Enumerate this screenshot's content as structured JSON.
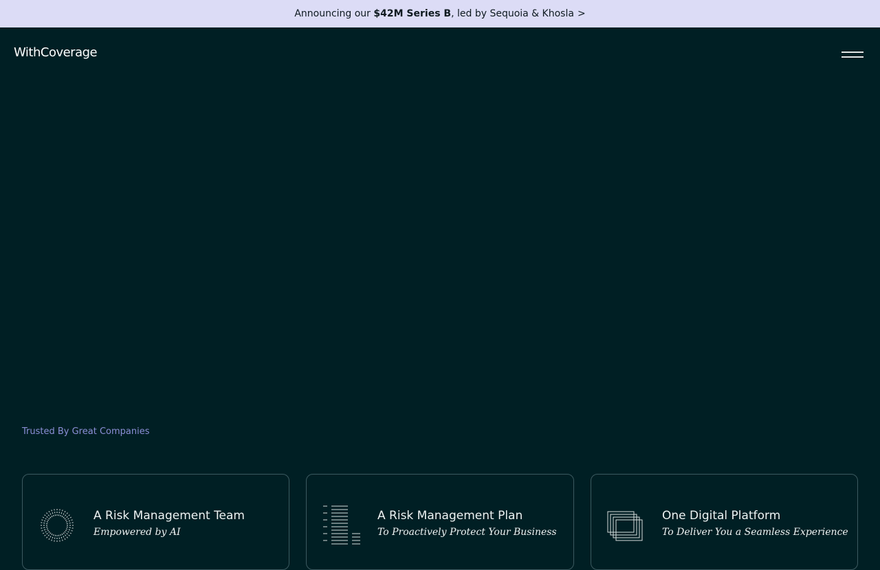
{
  "announcement": {
    "prefix": "Announcing our ",
    "highlight": "$42M Series B",
    "suffix": ", led by Sequoia & Khosla",
    "arrow": ">"
  },
  "nav": {
    "logo": "WithCoverage",
    "menu_icon": "hamburger-menu-icon"
  },
  "trusted": {
    "label": "Trusted By Great Companies"
  },
  "cards": [
    {
      "title": "A Risk Management Team",
      "subtitle": "Empowered by AI",
      "icon": "sunburst-icon"
    },
    {
      "title": "A Risk Management Plan",
      "subtitle": "To Proactively Protect Your Business",
      "icon": "document-lines-icon"
    },
    {
      "title": "One Digital Platform",
      "subtitle": "To Deliver You a Seamless Experience",
      "icon": "stacked-frames-icon"
    }
  ],
  "colors": {
    "background": "#001f24",
    "announcement_bg": "#dcdcf6",
    "accent_text": "#8b8fd6",
    "card_border": "#3c5a60"
  }
}
